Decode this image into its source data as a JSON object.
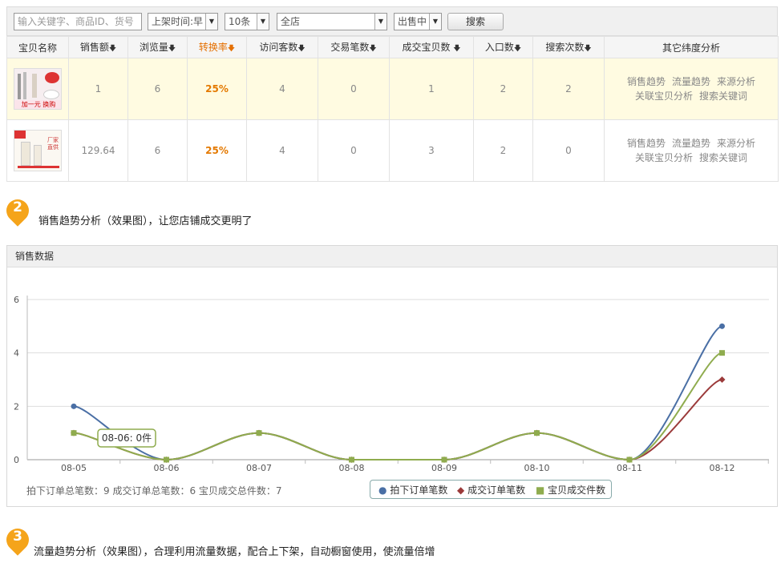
{
  "filter": {
    "search_placeholder": "输入关键字、商品ID、货号",
    "listing_time": "上架时间:早",
    "page_size": "10条",
    "shop_scope": "全店",
    "status": "出售中",
    "search_button": "搜索"
  },
  "table": {
    "columns": [
      "宝贝名称",
      "销售额",
      "浏览量",
      "转换率",
      "访问客数",
      "交易笔数",
      "成交宝贝数",
      "入口数",
      "搜索次数",
      "其它纬度分析"
    ],
    "rows": [
      {
        "sales": "1",
        "views": "6",
        "rate": "25%",
        "visitors": "4",
        "trades": "0",
        "items_sold": "1",
        "entries": "2",
        "searches": "2",
        "thumb_text": "加一元 换购"
      },
      {
        "sales": "129.64",
        "views": "6",
        "rate": "25%",
        "visitors": "4",
        "trades": "0",
        "items_sold": "3",
        "entries": "2",
        "searches": "0",
        "thumb_text": "厂家直供"
      }
    ],
    "links": [
      "销售趋势",
      "流量趋势",
      "来源分析",
      "关联宝贝分析",
      "搜索关键词"
    ]
  },
  "sections": {
    "s2_num": "2",
    "s2_title": "销售趋势分析（效果图），让您店铺成交更明了",
    "s3_num": "3",
    "s3_title": "流量趋势分析（效果图），合理利用流量数据，配合上下架，自动橱窗使用，使流量倍增"
  },
  "panel_title": "销售数据",
  "totals_text": "拍下订单总笔数：9 成交订单总笔数：6 宝贝成交总件数：7",
  "tooltip_text": "08-06: 0件",
  "colors": {
    "accent_orange": "#f5a41a",
    "link_blue": "#1a5aa8",
    "series_blue": "#4a6fa5",
    "series_red": "#9b3a3a",
    "series_green": "#8fac4e"
  },
  "chart_data": {
    "type": "line",
    "categories": [
      "08-05",
      "08-06",
      "08-07",
      "08-08",
      "08-09",
      "08-10",
      "08-11",
      "08-12"
    ],
    "ylim": [
      0,
      6
    ],
    "yticks": [
      0,
      2,
      4,
      6
    ],
    "grid": true,
    "legend_position": "bottom",
    "series": [
      {
        "name": "拍下订单笔数",
        "values": [
          2,
          0,
          1,
          0,
          0,
          1,
          0,
          5
        ]
      },
      {
        "name": "成交订单笔数",
        "values": [
          1,
          0,
          1,
          0,
          0,
          1,
          0,
          3
        ]
      },
      {
        "name": "宝贝成交件数",
        "values": [
          1,
          0,
          1,
          0,
          0,
          1,
          0,
          4
        ]
      }
    ]
  }
}
